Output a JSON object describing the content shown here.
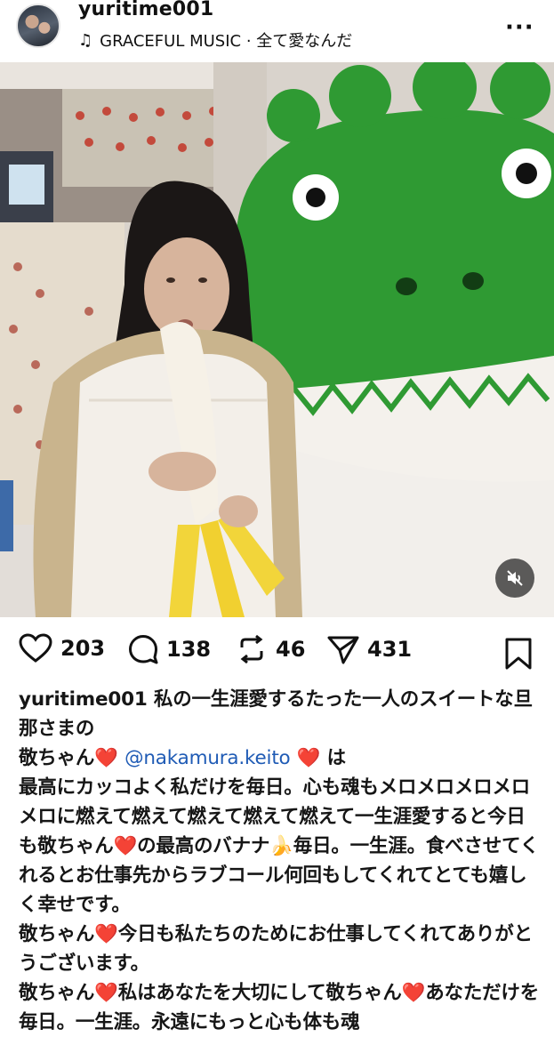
{
  "post": {
    "username": "yuritime001",
    "music": {
      "icon": "music-note-icon",
      "label": "GRACEFUL MUSIC · 全て愛なんだ"
    },
    "more_icon": "more-options-icon"
  },
  "photo": {
    "description_icon": "photo",
    "mute_icon": "speaker-muted-icon"
  },
  "actions": {
    "likes": "203",
    "comments": "138",
    "reposts": "46",
    "shares": "431"
  },
  "caption": {
    "username": "yuritime001",
    "line1_text": " 私の一生涯愛するたった一人のスイートな旦那さまの",
    "p2_prefix": "敬ちゃん",
    "heart": "❤️",
    "mention": "@nakamura.keito",
    "p2_suffix": " は",
    "p3_text_a": "最高にカッコよく私だけを毎日。心も魂もメロメロメロメロメロに燃えて燃えて燃えて燃えて燃えて一生涯愛すると今日も敬ちゃん",
    "p3_text_b": "の最高のバナナ",
    "banana": "🍌",
    "p3_text_c": "毎日。一生涯。食べさせてくれるとお仕事先からラブコール何回もしてくれてとても嬉しく幸せです。",
    "p4_prefix": "敬ちゃん",
    "p4_text": "今日も私たちのためにお仕事してくれてありがとうございます。",
    "p5_prefix": "敬ちゃん",
    "p5_text_a": "私はあなたを大切にして敬ちゃん",
    "p5_text_b": "あなただけを毎日。一生涯。永遠にもっと心も体も魂"
  },
  "colors": {
    "mention": "#1f5bb5",
    "heart": "#e02929",
    "mascot_green": "#2f9a33"
  }
}
